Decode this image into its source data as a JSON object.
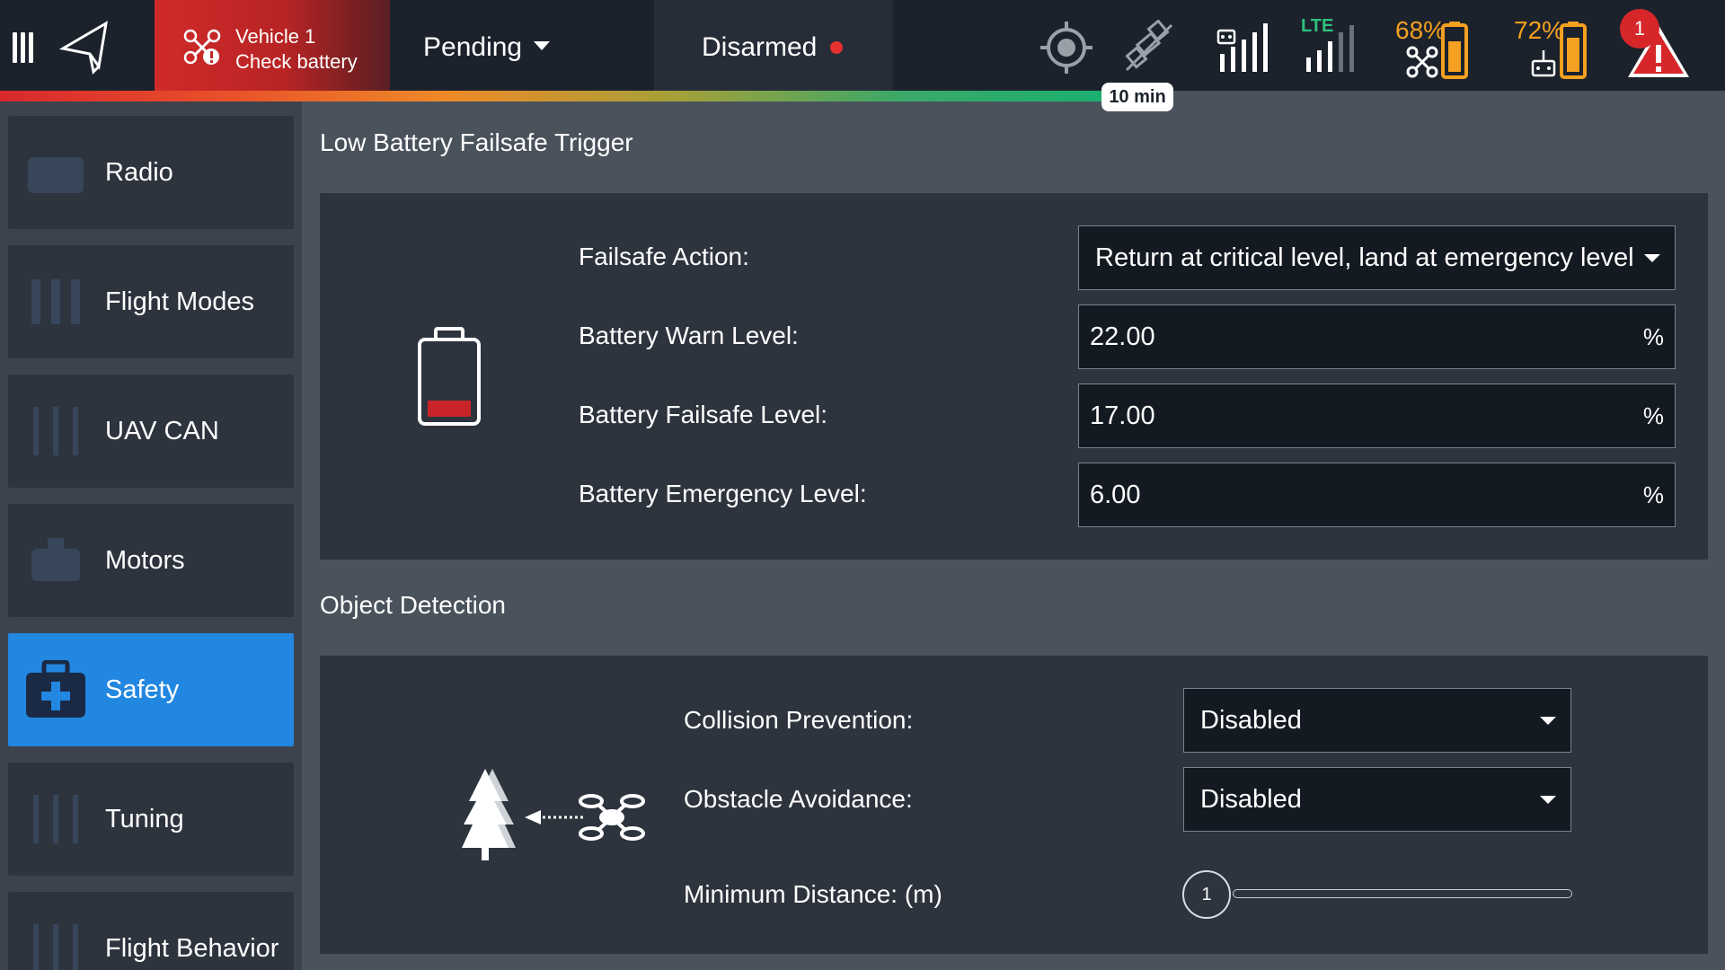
{
  "topbar": {
    "vehicle_line1": "Vehicle 1",
    "vehicle_line2": "Check battery",
    "flight_mode": "Pending",
    "arm_status": "Disarmed",
    "lte_label": "LTE",
    "drone_battery": "68%",
    "controller_battery": "72%",
    "alert_count": "1",
    "flight_time_remaining": "10 min",
    "progress_percent": 65
  },
  "sidebar": {
    "items": [
      {
        "label": "Radio",
        "icon": "radio-icon"
      },
      {
        "label": "Flight Modes",
        "icon": "flight-modes-icon"
      },
      {
        "label": "UAV CAN",
        "icon": "uav-can-icon"
      },
      {
        "label": "Motors",
        "icon": "motors-icon"
      },
      {
        "label": "Safety",
        "icon": "safety-icon"
      },
      {
        "label": "Tuning",
        "icon": "tuning-icon"
      },
      {
        "label": "Flight Behavior",
        "icon": "flight-behavior-icon"
      }
    ],
    "active": "Safety"
  },
  "battery_section": {
    "title": "Low Battery Failsafe Trigger",
    "failsafe_action_label": "Failsafe Action:",
    "failsafe_action_value": "Return at critical level, land at emergency level",
    "warn_label": "Battery Warn Level:",
    "warn_value": "22.00",
    "failsafe_label": "Battery Failsafe Level:",
    "failsafe_value": "17.00",
    "emergency_label": "Battery Emergency Level:",
    "emergency_value": "6.00",
    "unit": "%"
  },
  "object_section": {
    "title": "Object Detection",
    "collision_label": "Collision Prevention:",
    "collision_value": "Disabled",
    "avoidance_label": "Obstacle Avoidance:",
    "avoidance_value": "Disabled",
    "min_distance_label": "Minimum Distance: (m)",
    "min_distance_value": "1"
  },
  "colors": {
    "accent": "#2287e0",
    "alert": "#d6262a",
    "battery_warning": "#f4a020",
    "lte": "#2ec27e"
  }
}
